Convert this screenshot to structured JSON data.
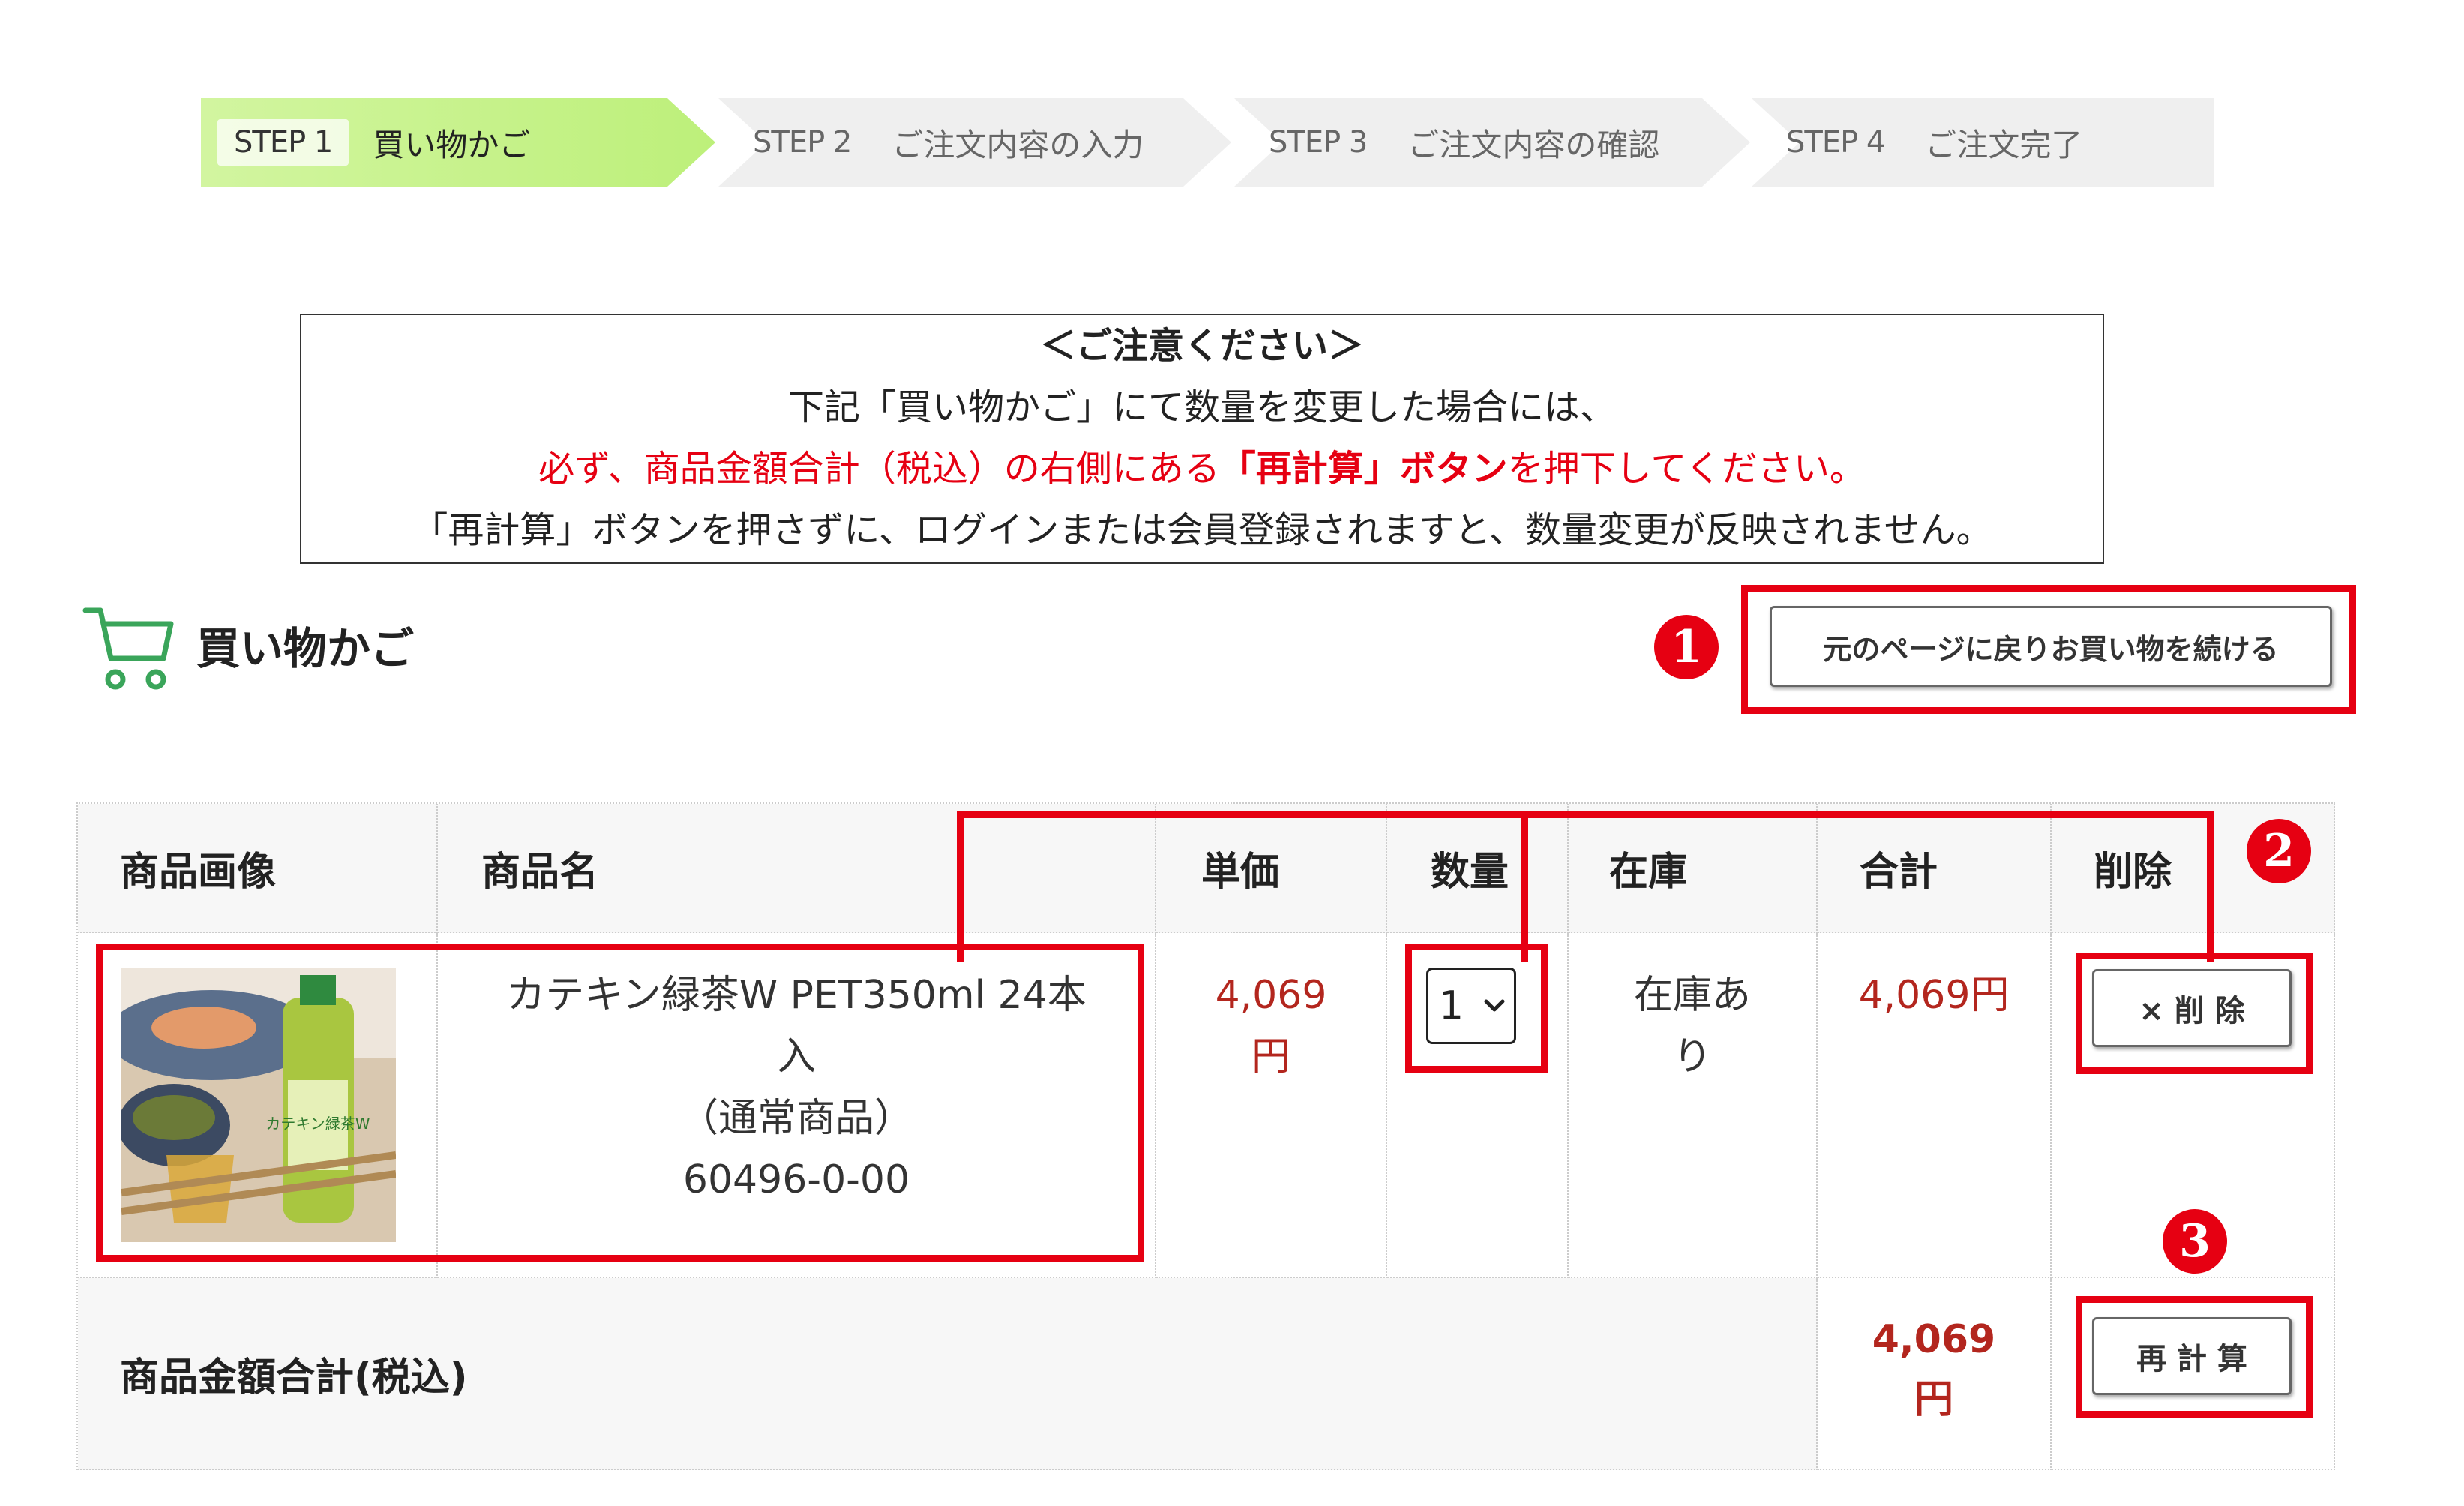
{
  "steps": [
    {
      "num": "STEP 1",
      "label": "買い物かご",
      "active": true
    },
    {
      "num": "STEP 2",
      "label": "ご注文内容の入力",
      "active": false
    },
    {
      "num": "STEP 3",
      "label": "ご注文内容の確認",
      "active": false
    },
    {
      "num": "STEP 4",
      "label": "ご注文完了",
      "active": false
    }
  ],
  "notice": {
    "title": "＜ご注意ください＞",
    "line1": "下記「買い物かご」にて数量を変更した場合には、",
    "line2_pre": "必ず、商品金額合計（税込）の右側にある",
    "line2_strong": "「再計算」ボタン",
    "line2_post": "を押下してください。",
    "line3": "「再計算」ボタンを押さずに、ログインまたは会員登録されますと、数量変更が反映されません。"
  },
  "cart": {
    "title": "買い物かご",
    "continue_button": "元のページに戻りお買い物を続ける"
  },
  "table": {
    "headers": {
      "image": "商品画像",
      "name": "商品名",
      "unit_price": "単価",
      "quantity": "数量",
      "stock": "在庫",
      "total": "合計",
      "delete": "削除"
    },
    "row": {
      "name_line1": "カテキン緑茶W PET350ml 24本",
      "name_line2": "入",
      "name_line3": "（通常商品）",
      "code": "60496-0-00",
      "unit_price_line1": "4,069",
      "unit_price_line2": "円",
      "quantity": "1",
      "stock_line1": "在庫あ",
      "stock_line2": "り",
      "total": "4,069円",
      "delete_button": "× 削 除",
      "product_label": "カテキン緑茶W"
    },
    "summary": {
      "label": "商品金額合計(税込)",
      "total_line1": "4,069",
      "total_line2": "円",
      "recalc_button": "再 計 算"
    }
  },
  "markers": [
    "1",
    "2",
    "3"
  ],
  "colors": {
    "accent_red": "#e60012",
    "price_red": "#b3261e",
    "step_active": "#c8f08a"
  }
}
